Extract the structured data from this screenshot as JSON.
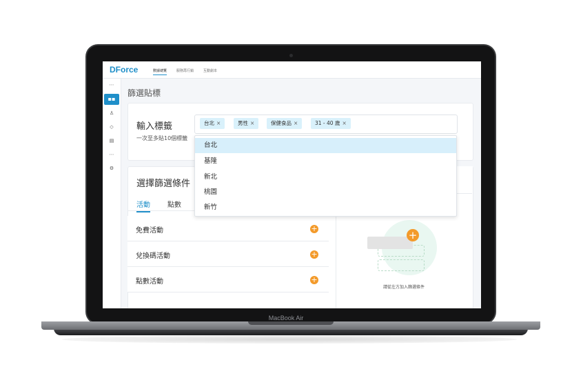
{
  "device": {
    "brand_label": "MacBook Air"
  },
  "app": {
    "logo": {
      "first": "DF",
      "rest": "orce"
    },
    "nav": [
      "數據總覽",
      "服務再行銷",
      "互動劇本"
    ],
    "page_title": "篩選貼標"
  },
  "sidebar": {
    "icons": [
      "more-icon",
      "dashboard-icon",
      "users-icon",
      "tag-icon",
      "database-icon",
      "more-icon",
      "settings-icon"
    ]
  },
  "tag_input": {
    "label": "輸入標籤",
    "hint": "一次至多貼10個標籤",
    "tags": [
      "台北",
      "男性",
      "保健食品",
      "31 - 40 歲"
    ],
    "remove_glyph": "×"
  },
  "dropdown": {
    "options": [
      "台北",
      "基隆",
      "新北",
      "桃園",
      "新竹"
    ],
    "highlighted": "台北"
  },
  "conditions": {
    "title": "選擇篩選條件",
    "tabs": [
      "活動",
      "點數"
    ],
    "active_tab": "活動",
    "rows": [
      "免費活動",
      "兌換碼活動",
      "點數活動"
    ],
    "add_glyph": "+"
  },
  "right_panel": {
    "caption": "請從左方加入篩選條件",
    "add_glyph": "+"
  },
  "colors": {
    "accent": "#1f8fc9",
    "orange": "#f39a2a",
    "highlight": "#d7effb",
    "tag_bg": "#d9f1fb"
  }
}
